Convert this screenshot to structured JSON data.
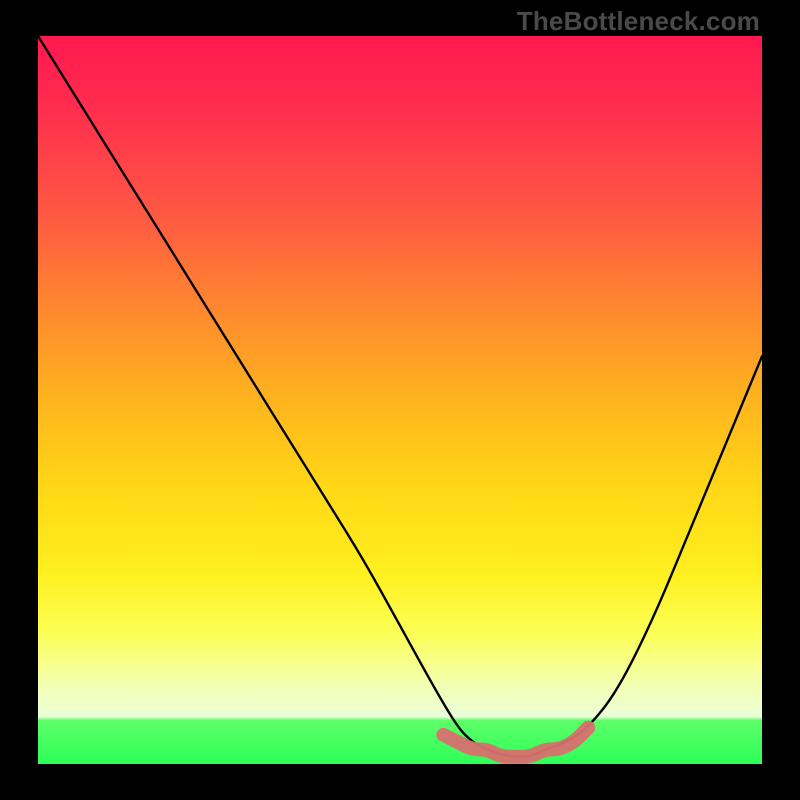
{
  "watermark": "TheBottleneck.com",
  "chart_data": {
    "type": "line",
    "title": "",
    "xlabel": "",
    "ylabel": "",
    "xlim": [
      0,
      100
    ],
    "ylim": [
      0,
      100
    ],
    "series": [
      {
        "name": "bottleneck-curve",
        "x": [
          0,
          5,
          10,
          15,
          20,
          25,
          30,
          35,
          40,
          45,
          50,
          55,
          58,
          60,
          62,
          65,
          68,
          70,
          73,
          76,
          80,
          85,
          90,
          95,
          100
        ],
        "values": [
          100,
          92,
          84,
          76,
          68,
          60,
          52,
          44,
          36,
          28,
          19,
          10,
          5,
          3,
          2,
          1,
          1,
          2,
          3,
          5,
          10,
          20,
          32,
          44,
          56
        ]
      },
      {
        "name": "optimum-band",
        "x": [
          56,
          58,
          60,
          62,
          64,
          66,
          68,
          70,
          72,
          74,
          76
        ],
        "values": [
          4,
          3,
          2,
          2,
          1,
          1,
          1,
          2,
          2,
          3,
          5
        ]
      }
    ],
    "annotations": []
  },
  "colors": {
    "curve": "#000000",
    "optimum_band": "#d8706e",
    "background_top": "#ff1850",
    "background_bottom": "#2dff57",
    "frame": "#000000"
  }
}
